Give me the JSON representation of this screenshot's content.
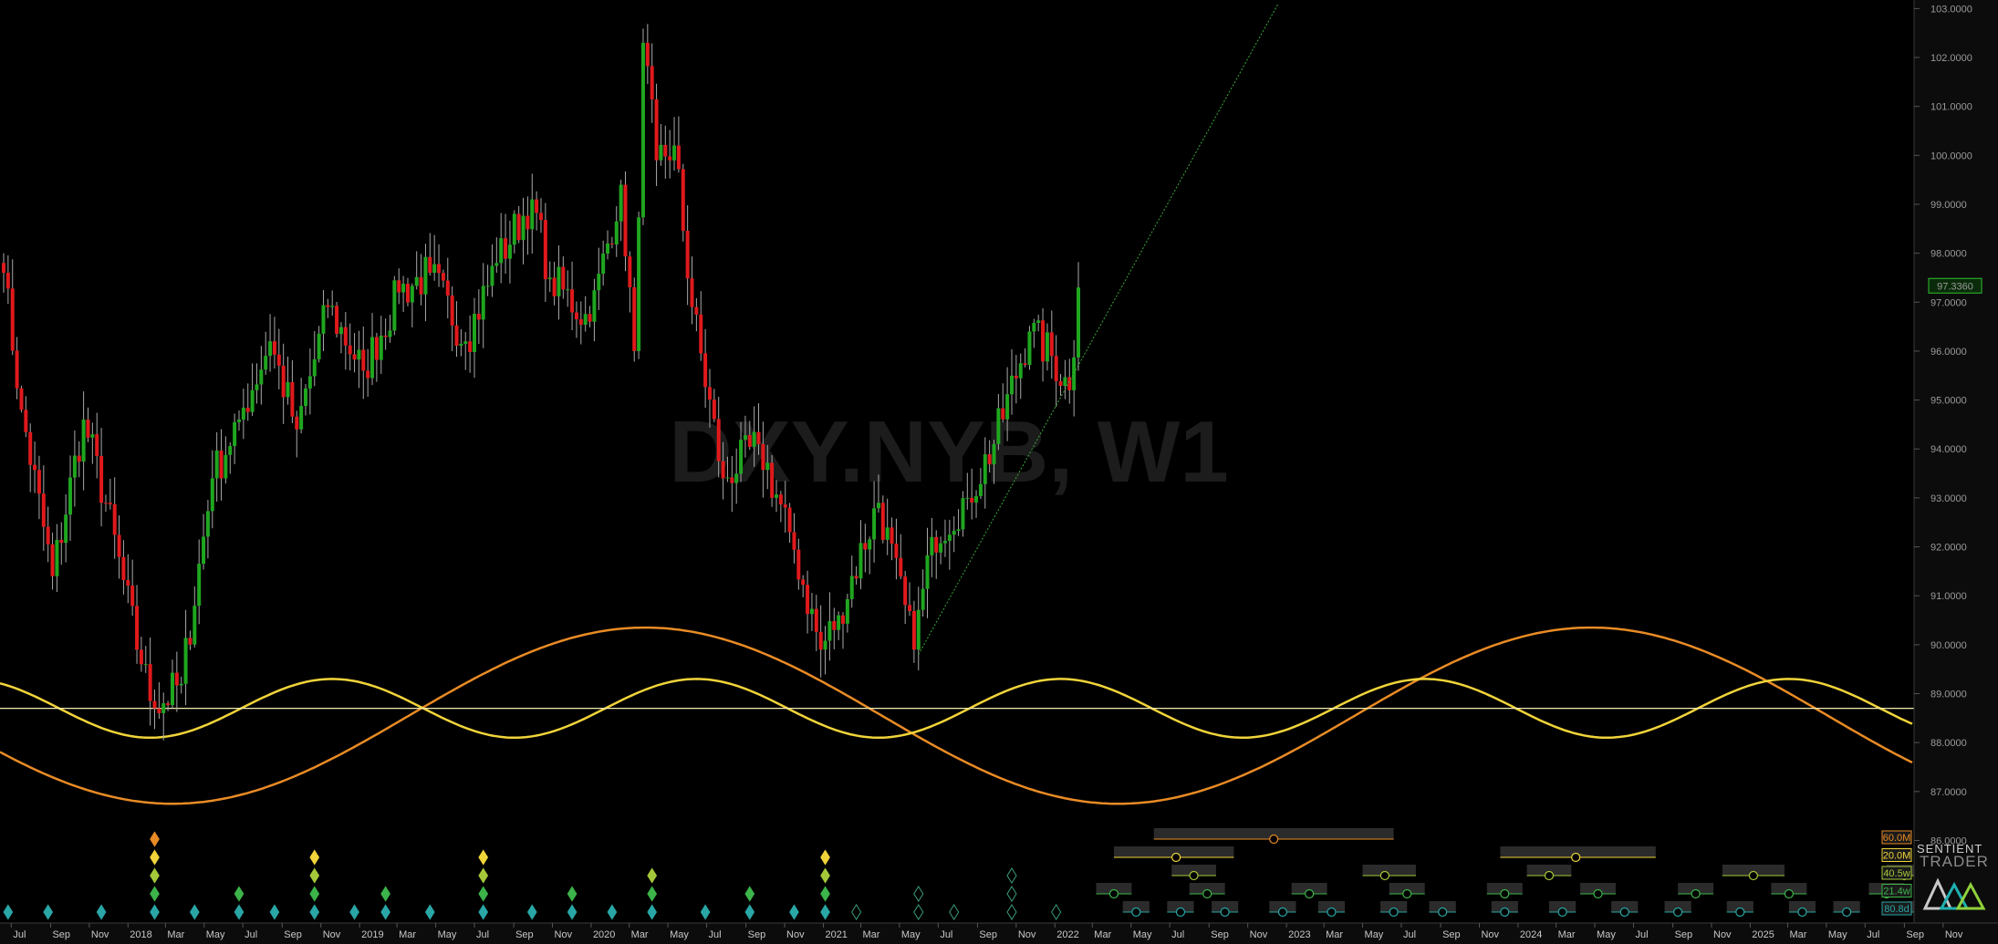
{
  "chart_data": {
    "type": "candlestick",
    "title": "DXY.NYB, W1",
    "price_axis": {
      "ticks": [
        "103.0000",
        "102.0000",
        "101.0000",
        "100.0000",
        "99.0000",
        "98.0000",
        "97.0000",
        "96.0000",
        "95.0000",
        "94.0000",
        "93.0000",
        "92.0000",
        "91.0000",
        "90.0000",
        "89.0000",
        "88.0000",
        "87.0000",
        "86.0000"
      ],
      "ylim": [
        85.2,
        103.1
      ],
      "last_price": "97.3360",
      "last_price_value": 97.336,
      "horizontal_line_value": 88.7
    },
    "time_axis": {
      "labels": [
        "Jul",
        "Sep",
        "Nov",
        "2018",
        "Mar",
        "May",
        "Jul",
        "Sep",
        "Nov",
        "2019",
        "Mar",
        "May",
        "Jul",
        "Sep",
        "Nov",
        "2020",
        "Mar",
        "May",
        "Jul",
        "Sep",
        "Nov",
        "2021",
        "Mar",
        "May",
        "Jul",
        "Sep",
        "Nov",
        "2022",
        "Mar",
        "May",
        "Jul",
        "Sep",
        "Nov",
        "2023",
        "Mar",
        "May",
        "Jul",
        "Sep",
        "Nov",
        "2024",
        "Mar",
        "May",
        "Jul",
        "Sep",
        "Nov",
        "2025",
        "Mar",
        "May",
        "Jul",
        "Sep",
        "Nov"
      ],
      "start": "2017-06-19",
      "end": "2025-11-30"
    },
    "price_anchors": [
      {
        "date": "2017-06-19",
        "close": 97.6
      },
      {
        "date": "2017-07-17",
        "close": 94.8
      },
      {
        "date": "2017-09-04",
        "close": 91.4
      },
      {
        "date": "2017-10-23",
        "close": 94.6
      },
      {
        "date": "2017-11-27",
        "close": 92.9
      },
      {
        "date": "2018-01-22",
        "close": 89.6
      },
      {
        "date": "2018-02-12",
        "close": 88.7
      },
      {
        "date": "2018-03-26",
        "close": 89.2
      },
      {
        "date": "2018-05-14",
        "close": 93.4
      },
      {
        "date": "2018-06-25",
        "close": 94.6
      },
      {
        "date": "2018-08-13",
        "close": 96.2
      },
      {
        "date": "2018-09-24",
        "close": 94.4
      },
      {
        "date": "2018-11-12",
        "close": 96.9
      },
      {
        "date": "2019-01-07",
        "close": 95.6
      },
      {
        "date": "2019-03-04",
        "close": 97.2
      },
      {
        "date": "2019-04-22",
        "close": 97.6
      },
      {
        "date": "2019-06-17",
        "close": 96.2
      },
      {
        "date": "2019-08-05",
        "close": 97.8
      },
      {
        "date": "2019-09-30",
        "close": 99.1
      },
      {
        "date": "2019-10-28",
        "close": 97.5
      },
      {
        "date": "2019-12-30",
        "close": 96.6
      },
      {
        "date": "2020-02-17",
        "close": 99.4
      },
      {
        "date": "2020-03-09",
        "close": 96.0
      },
      {
        "date": "2020-03-23",
        "close": 102.3
      },
      {
        "date": "2020-04-13",
        "close": 99.9
      },
      {
        "date": "2020-05-11",
        "close": 100.2
      },
      {
        "date": "2020-06-08",
        "close": 96.9
      },
      {
        "date": "2020-07-27",
        "close": 93.4
      },
      {
        "date": "2020-09-21",
        "close": 94.1
      },
      {
        "date": "2020-11-09",
        "close": 92.3
      },
      {
        "date": "2020-12-28",
        "close": 89.9
      },
      {
        "date": "2021-01-25",
        "close": 90.6
      },
      {
        "date": "2021-03-29",
        "close": 92.9
      },
      {
        "date": "2021-05-24",
        "close": 89.9
      },
      {
        "date": "2021-06-21",
        "close": 92.2
      },
      {
        "date": "2021-08-16",
        "close": 93.0
      },
      {
        "date": "2021-09-27",
        "close": 94.1
      },
      {
        "date": "2021-11-22",
        "close": 96.4
      },
      {
        "date": "2021-12-27",
        "close": 95.9
      },
      {
        "date": "2022-01-24",
        "close": 95.2
      },
      {
        "date": "2022-02-07",
        "close": 97.3
      }
    ],
    "trendline": {
      "from": {
        "date": "2021-05-31",
        "value": 89.8
      },
      "to": {
        "date": "2022-12-19",
        "value": 103.1
      },
      "color": "#3aa83a"
    },
    "cycles": [
      {
        "color": "#e98b25",
        "amplitude": 1.8,
        "center": 88.55,
        "trough_date": "2018-03-12",
        "period_weeks": 213
      },
      {
        "color": "#f1d43a",
        "amplitude": 0.6,
        "center": 88.7,
        "trough_date": "2018-02-05",
        "period_weeks": 82
      }
    ],
    "cycle_period_labels": [
      {
        "text": "60.0M",
        "color": "#e98b25"
      },
      {
        "text": "20.0M",
        "color": "#f1d43a"
      },
      {
        "text": "40.5w",
        "color": "#a5c83a"
      },
      {
        "text": "21.4w",
        "color": "#3cb44a"
      },
      {
        "text": "80.8d",
        "color": "#2aa6a6"
      }
    ],
    "phase_markers": [
      {
        "date": "2017-06-26",
        "levels": [
          1
        ]
      },
      {
        "date": "2017-08-28",
        "levels": [
          1
        ]
      },
      {
        "date": "2017-11-20",
        "levels": [
          1
        ]
      },
      {
        "date": "2018-02-12",
        "levels": [
          5,
          4,
          3,
          2,
          1
        ]
      },
      {
        "date": "2018-04-16",
        "levels": [
          1
        ]
      },
      {
        "date": "2018-06-25",
        "levels": [
          2,
          1
        ]
      },
      {
        "date": "2018-08-20",
        "levels": [
          1
        ]
      },
      {
        "date": "2018-10-22",
        "levels": [
          4,
          3,
          2,
          1
        ]
      },
      {
        "date": "2018-12-24",
        "levels": [
          1
        ]
      },
      {
        "date": "2019-02-11",
        "levels": [
          2,
          1
        ]
      },
      {
        "date": "2019-04-22",
        "levels": [
          1
        ]
      },
      {
        "date": "2019-07-15",
        "levels": [
          4,
          3,
          2,
          1
        ]
      },
      {
        "date": "2019-09-30",
        "levels": [
          1
        ]
      },
      {
        "date": "2019-12-02",
        "levels": [
          2,
          1
        ]
      },
      {
        "date": "2020-02-03",
        "levels": [
          1
        ]
      },
      {
        "date": "2020-04-06",
        "levels": [
          3,
          2,
          1
        ]
      },
      {
        "date": "2020-06-29",
        "levels": [
          1
        ]
      },
      {
        "date": "2020-09-07",
        "levels": [
          2,
          1
        ]
      },
      {
        "date": "2020-11-16",
        "levels": [
          1
        ]
      },
      {
        "date": "2021-01-04",
        "levels": [
          4,
          3,
          2,
          1
        ]
      }
    ],
    "projected_markers": [
      {
        "date": "2021-02-22",
        "levels": [
          1
        ]
      },
      {
        "date": "2021-05-31",
        "levels": [
          2,
          1
        ]
      },
      {
        "date": "2021-07-26",
        "levels": [
          1
        ]
      },
      {
        "date": "2021-10-25",
        "levels": [
          3,
          2,
          1
        ]
      },
      {
        "date": "2022-01-03",
        "levels": [
          1
        ]
      }
    ],
    "future_windows": [
      {
        "start": "2022-06-06",
        "end": "2023-06-19",
        "center": "2022-12-12",
        "level": 5
      },
      {
        "start": "2022-04-04",
        "end": "2022-10-10",
        "center": "2022-07-11",
        "level": 4
      },
      {
        "start": "2023-12-04",
        "end": "2024-08-05",
        "center": "2024-04-01",
        "level": 4
      },
      {
        "start": "2022-07-04",
        "end": "2022-09-12",
        "center": "2022-08-08",
        "level": 3
      },
      {
        "start": "2023-05-01",
        "end": "2023-07-24",
        "center": "2023-06-05",
        "level": 3
      },
      {
        "start": "2024-01-15",
        "end": "2024-03-25",
        "center": "2024-02-19",
        "level": 3
      },
      {
        "start": "2024-11-18",
        "end": "2025-02-24",
        "center": "2025-01-06",
        "level": 3
      },
      {
        "start": "2025-08-04",
        "end": "2025-09-29",
        "center": "2025-09-01",
        "level": 3
      },
      {
        "start": "2022-03-07",
        "end": "2022-05-02",
        "center": "2022-04-04",
        "level": 2
      },
      {
        "start": "2022-08-01",
        "end": "2022-09-26",
        "center": "2022-08-29",
        "level": 2
      },
      {
        "start": "2023-01-09",
        "end": "2023-03-06",
        "center": "2023-02-06",
        "level": 2
      },
      {
        "start": "2023-06-12",
        "end": "2023-08-07",
        "center": "2023-07-10",
        "level": 2
      },
      {
        "start": "2023-11-13",
        "end": "2024-01-08",
        "center": "2023-12-11",
        "level": 2
      },
      {
        "start": "2024-04-08",
        "end": "2024-06-03",
        "center": "2024-05-06",
        "level": 2
      },
      {
        "start": "2024-09-09",
        "end": "2024-11-04",
        "center": "2024-10-07",
        "level": 2
      },
      {
        "start": "2025-02-03",
        "end": "2025-03-31",
        "center": "2025-03-03",
        "level": 2
      },
      {
        "start": "2025-07-07",
        "end": "2025-09-01",
        "center": "2025-08-04",
        "level": 2
      },
      {
        "start": "2022-04-18",
        "end": "2022-05-30",
        "center": "2022-05-09",
        "level": 1
      },
      {
        "start": "2022-06-27",
        "end": "2022-08-08",
        "center": "2022-07-18",
        "level": 1
      },
      {
        "start": "2022-09-05",
        "end": "2022-10-17",
        "center": "2022-09-26",
        "level": 1
      },
      {
        "start": "2022-12-05",
        "end": "2023-01-16",
        "center": "2022-12-26",
        "level": 1
      },
      {
        "start": "2023-02-20",
        "end": "2023-04-03",
        "center": "2023-03-13",
        "level": 1
      },
      {
        "start": "2023-05-29",
        "end": "2023-07-10",
        "center": "2023-06-19",
        "level": 1
      },
      {
        "start": "2023-08-14",
        "end": "2023-09-25",
        "center": "2023-09-04",
        "level": 1
      },
      {
        "start": "2023-11-20",
        "end": "2024-01-01",
        "center": "2023-12-11",
        "level": 1
      },
      {
        "start": "2024-02-19",
        "end": "2024-04-01",
        "center": "2024-03-11",
        "level": 1
      },
      {
        "start": "2024-05-27",
        "end": "2024-07-08",
        "center": "2024-06-17",
        "level": 1
      },
      {
        "start": "2024-08-19",
        "end": "2024-09-30",
        "center": "2024-09-09",
        "level": 1
      },
      {
        "start": "2024-11-25",
        "end": "2025-01-06",
        "center": "2024-12-16",
        "level": 1
      },
      {
        "start": "2025-03-03",
        "end": "2025-04-14",
        "center": "2025-03-24",
        "level": 1
      },
      {
        "start": "2025-05-12",
        "end": "2025-06-23",
        "center": "2025-06-02",
        "level": 1
      },
      {
        "start": "2025-09-08",
        "end": "2025-10-20",
        "center": "2025-09-29",
        "level": 1
      }
    ],
    "colors": {
      "up": "#1fa61f",
      "down": "#e0191b",
      "level1": "#2aa6a6",
      "level2": "#3cb44a",
      "level3": "#a5c83a",
      "level4": "#f1d43a",
      "level5": "#e98b25"
    }
  },
  "logo": {
    "line1": "SENTIENT",
    "line2": "TRADER"
  }
}
